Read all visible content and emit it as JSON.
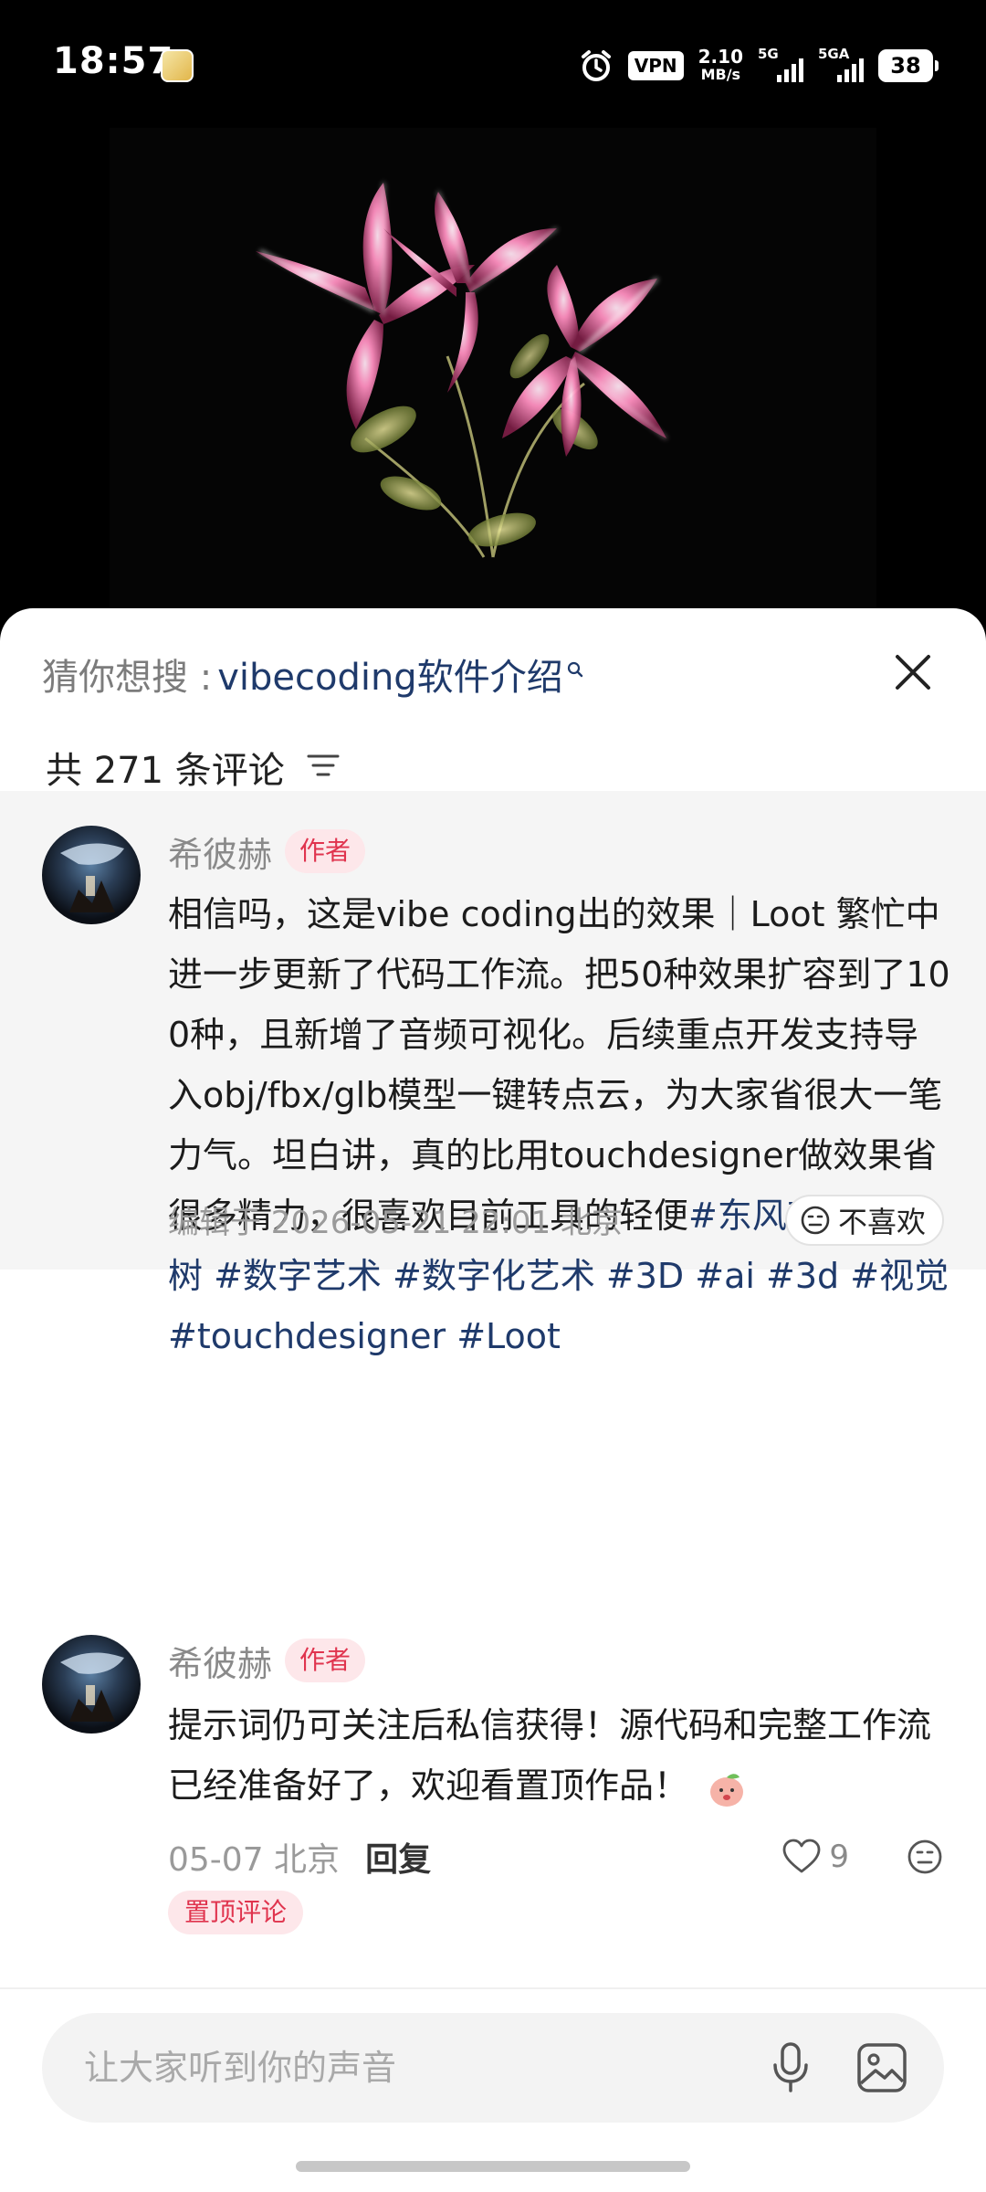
{
  "status_bar": {
    "time": "18:57",
    "vpn": "VPN",
    "speed_value": "2.10",
    "speed_unit": "MB/s",
    "sim1": "5G",
    "sim2": "5GA",
    "battery": "38"
  },
  "search_suggest": {
    "prefix": "猜你想搜 : ",
    "query": "vibecoding软件介绍"
  },
  "comments_header": {
    "count_text": "共 271 条评论"
  },
  "comment1": {
    "author": "希彼赫",
    "author_tag": "作者",
    "text_main": "相信吗，这是vibe coding出的效果｜Loot 繁忙中进一步更新了代码工作流。把50种效果扩容到了100种，且新增了音频可视化。后续重点开发支持导入obj/fbx/glb模型一键转点云，为大家省很大一笔力气。坦白讲，真的比用touchdesigner做效果省很多精力，很喜欢目前工具的轻便",
    "text_tags": "#东风夜放花千树 #数字艺术 #数字化艺术 #3D #ai #3d #视觉 #touchdesigner #Loot",
    "edited_meta": "编辑于 2026-05-21 22:01 北京",
    "dislike_label": "不喜欢"
  },
  "comment2": {
    "author": "希彼赫",
    "author_tag": "作者",
    "text": "提示词仍可关注后私信获得！源代码和完整工作流已经准备好了，欢迎看置顶作品！",
    "date_location": "05-07 北京",
    "reply_label": "回复",
    "like_count": "9",
    "pinned_label": "置顶评论"
  },
  "input": {
    "placeholder": "让大家听到你的声音"
  },
  "colors": {
    "link_blue": "#1f3a6b",
    "tag_red": "#e0344e",
    "tag_bg": "#fde7ea"
  }
}
